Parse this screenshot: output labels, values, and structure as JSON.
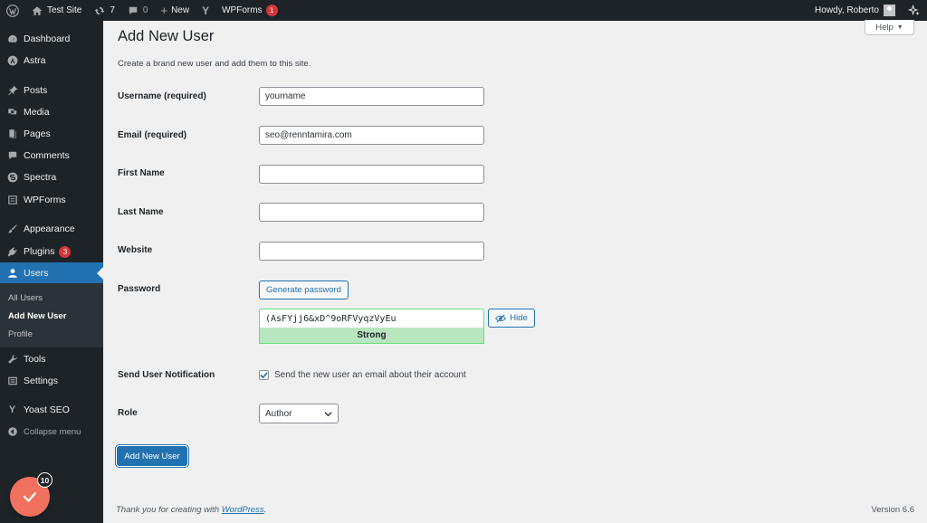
{
  "admin_bar": {
    "site_name": "Test Site",
    "updates_count": "7",
    "comments_count": "0",
    "new_label": "New",
    "wpforms_label": "WPForms",
    "wpforms_badge": "1",
    "greeting": "Howdy, Roberto"
  },
  "sidebar": {
    "items": [
      {
        "label": "Dashboard",
        "icon": "dashboard-icon"
      },
      {
        "label": "Astra",
        "icon": "astra-icon"
      },
      {
        "label": "Posts",
        "icon": "pin-icon"
      },
      {
        "label": "Media",
        "icon": "media-icon"
      },
      {
        "label": "Pages",
        "icon": "page-icon"
      },
      {
        "label": "Comments",
        "icon": "comment-icon"
      },
      {
        "label": "Spectra",
        "icon": "spectra-icon"
      },
      {
        "label": "WPForms",
        "icon": "form-icon"
      },
      {
        "label": "Appearance",
        "icon": "brush-icon"
      },
      {
        "label": "Plugins",
        "icon": "plugin-icon",
        "badge": "3"
      },
      {
        "label": "Users",
        "icon": "user-icon"
      },
      {
        "label": "Tools",
        "icon": "wrench-icon"
      },
      {
        "label": "Settings",
        "icon": "settings-icon"
      },
      {
        "label": "Yoast SEO",
        "icon": "yoast-icon"
      },
      {
        "label": "Collapse menu",
        "icon": "collapse-icon"
      }
    ],
    "submenu": [
      "All Users",
      "Add New User",
      "Profile"
    ]
  },
  "page": {
    "help_label": "Help",
    "title": "Add New User",
    "intro": "Create a brand new user and add them to this site."
  },
  "form": {
    "username_label": "Username (required)",
    "username_value": "yourname",
    "email_label": "Email (required)",
    "email_value": "seo@renntamira.com",
    "first_name_label": "First Name",
    "last_name_label": "Last Name",
    "website_label": "Website",
    "password_label": "Password",
    "generate_label": "Generate password",
    "password_value": "(AsFYjj6&xD^9oRFVyqzVyEu",
    "hide_label": "Hide",
    "strength_label": "Strong",
    "notification_label": "Send User Notification",
    "notification_text": "Send the new user an email about their account",
    "role_label": "Role",
    "role_value": "Author",
    "submit_label": "Add New User"
  },
  "footer": {
    "thanks_prefix": "Thank you for creating with ",
    "thanks_link": "WordPress",
    "thanks_suffix": ".",
    "version": "Version 6.6"
  },
  "notification_badge": "10",
  "colors": {
    "admin_dark": "#1d2327",
    "accent": "#2271b1",
    "badge_red": "#d63638",
    "strength_green": "#b8e6bf",
    "fab_orange": "#f0715e"
  }
}
